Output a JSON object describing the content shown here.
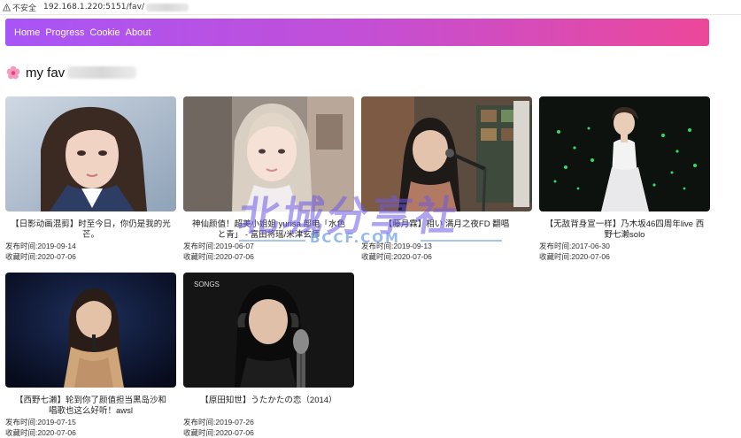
{
  "browser": {
    "security_label": "不安全",
    "url": "192.168.1.220:5151/fav/"
  },
  "nav": {
    "items": [
      "Home",
      "Progress",
      "Cookie",
      "About"
    ]
  },
  "page": {
    "title": "my fav"
  },
  "videos": [
    {
      "title": "【日影动画混剪】时至今日，你仍是我的光芒。",
      "published": "发布时间:2019-09-14",
      "collected": "收藏时间:2020-07-06"
    },
    {
      "title": "神仙颜值！超美小姐姐 yurisa 部电「水色と青」 - 富田将瑶/米津玄师",
      "published": "发布时间:2019-06-07",
      "collected": "收藏时间:2020-07-06"
    },
    {
      "title": "【藤月霖】相い 满月之夜FD 翻唱",
      "published": "发布时间:2019-09-13",
      "collected": "收藏时间:2020-07-06"
    },
    {
      "title": "【无敌背身宣一样】乃木坂46四周年live 西野七濑solo",
      "published": "发布时间:2017-06-30",
      "collected": "收藏时间:2020-07-06"
    },
    {
      "title": "【西野七濑】轮到你了颜值担当黑岛沙和 唱歌也这么好听！awsl",
      "published": "发布时间:2019-07-15",
      "collected": "收藏时间:2020-07-06"
    },
    {
      "title": "【原田知世】うたかたの恋（2014）",
      "published": "发布时间:2019-07-26",
      "collected": "收藏时间:2020-07-06"
    }
  ],
  "thumb_labels": {
    "songs": "SONGS"
  },
  "watermark": {
    "cn": "北城分享社",
    "en": "BCCF.COM"
  }
}
